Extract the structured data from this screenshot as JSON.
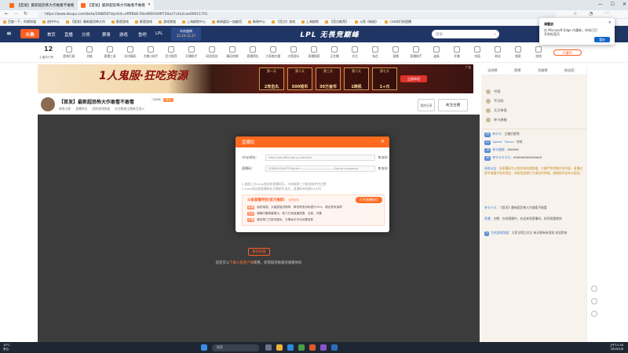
{
  "browser": {
    "tabs": [
      {
        "label": "【首发】最新超恐怖大作敢看不敢看"
      },
      {
        "label": "【首发】最新超恐怖大作敢看不敢看"
      }
    ],
    "url": "https://www.douyu.com/beta/208850?dyshid=ef0f6b8-56ed0003d9f720a27c4a2cae00011701",
    "favorites": [
      "百度一下，你就知道",
      "创作中心",
      "【直发】最新超恐怖大作",
      "影视游戏",
      "影视游戏",
      "游戏频道",
      "上海剧院中心",
      "新闻超话一加能用",
      "新闻中心",
      "【官方】游戏",
      "上海剧院",
      "【官方推荐】",
      "斗鱼《新剧》",
      "小伙伴们的直播"
    ]
  },
  "site": {
    "logo": "斗鱼",
    "nav": [
      "首页",
      "直播",
      "分类",
      "赛事",
      "游戏",
      "鱼吧",
      "LPL"
    ],
    "event_label": "年终盛典",
    "event_time": "12.20-12.27",
    "lpl_banner": "LPL 无畏竞巅峰",
    "search_placeholder": "搜索"
  },
  "catbar": {
    "day": "12",
    "day_label": "主播排行榜",
    "items": [
      "超神巨星",
      "功能",
      "直播工具",
      "实时精彩",
      "主播小助手",
      "官方推荐",
      "开播助手",
      "网游竞技",
      "精彩剪辑",
      "直播预告",
      "大家都在看",
      "大鹅游乐",
      "直播搜索",
      "正在播",
      "关注",
      "私信",
      "直播",
      "直播助手",
      "道具",
      "开播",
      "充值",
      "粉丝",
      "搜索",
      "游戏"
    ],
    "right_btn": "开播PC"
  },
  "ad": {
    "title": "1人鬼服·狂吃资源",
    "days": [
      {
        "label": "第一天",
        "reward": "2攻击丸"
      },
      {
        "label": "第二天",
        "reward": "500钱币"
      },
      {
        "label": "第三天",
        "reward": "30万金币"
      },
      {
        "label": "第六天",
        "reward": "1转机"
      },
      {
        "label": "第七天",
        "reward": "1+元"
      }
    ],
    "cta": "立即体验",
    "badge": "广告"
  },
  "room": {
    "title": "【首发】最新超恐怖大作敢看不敢看",
    "tag1": "1009",
    "tag2": "关注",
    "meta": [
      "哆啦小胖",
      "直播时长",
      "恐怖游戏频道",
      "关注数据主题每月进入"
    ],
    "share_label": "我的分享",
    "follow_label": "关注主播"
  },
  "video": {
    "play_btn": "重新加载",
    "tip_prefix": "您还可以",
    "tip_link": "下载斗鱼客户端",
    "tip_suffix": "观看，获得极净极速的观看体验"
  },
  "modal": {
    "title": "直播码",
    "rtmp_label": "rtmp地址：",
    "rtmp_value": "rtmp://sendfile.douyu.com/live",
    "key_label": "直播码：",
    "key_value": "20850rXGpEF3?dyHe=————————————&auth=wxgroup",
    "copy": "复制",
    "hints": [
      "1.复制上方rtmp地址和直播码后，与电脑第三方推流软件的位置",
      "2.rtmp地址和直播码在开播前生成后，直播码有效期24小时"
    ],
    "box_title": "斗鱼直播伴侣(官方推荐)",
    "box_title_tag": "推荐使用",
    "box_btn": "打开直播伴侣",
    "box_lines": [
      {
        "tag": "高清",
        "text": "画质增强、大幅提高流畅率、降低带宽消耗提升20%，稳定更有保障"
      },
      {
        "tag": "互动",
        "text": "弹幕内置弹幕展示，助力打造直播氛围、全面、可靠"
      },
      {
        "tag": "开播",
        "text": "兼容第三方推流程序，无需每次手动设置参数"
      }
    ]
  },
  "rpanel": {
    "tabs": [
      "全网榜",
      "周榜",
      "贡献榜",
      "粉丝团"
    ],
    "rank": [
      "中国",
      "不可知",
      "天天带宽",
      "哆卡旗舰"
    ],
    "chat": [
      {
        "lvl": "26",
        "nick": "哆卡卡",
        "text": "主播厉害啊"
      },
      {
        "lvl": "21",
        "nick": "Speed · Fanan",
        "text": "哈哈"
      },
      {
        "lvl": "18",
        "nick": "哆卡旗舰",
        "text": "666666"
      },
      {
        "lvl": "30",
        "nick": "哆卡卡卡卡卡",
        "text": "666666666666666"
      },
      {
        "lvl": "",
        "nick": "系统公告",
        "text": "本直播间为斗鱼恐怖游戏频道，主播严禁传播不良内容，直播过程中请遵守相关规定，如发现违规行为请及时举报，感谢您的支持与配合。"
      },
      {
        "lvl": "",
        "nick": "哆卡小卡",
        "text": "【首发】最新超恐怖大作敢看不敢看"
      },
      {
        "lvl": "",
        "nick": "直播",
        "text": "主播：在线直播中，欢迎来到直播间，祝你观看愉快"
      },
      {
        "lvl": "3",
        "nick": "主机游戏频道",
        "text": "大家记得点关注 每天都有新游戏 欢迎常来"
      }
    ]
  },
  "edge_popup": {
    "title": "请重启",
    "body": "在 Microsoft Edge 内重新，你有已打开的标签页",
    "button": "重启"
  },
  "taskbar": {
    "weather_temp": "10°C",
    "weather_desc": "多云",
    "search": "搜索",
    "time": "上午11:34",
    "date": "2025/1/6"
  },
  "colors": {
    "accent": "#ff5d23",
    "header": "#1f3564",
    "chatpanel": "#f7f3ec"
  }
}
